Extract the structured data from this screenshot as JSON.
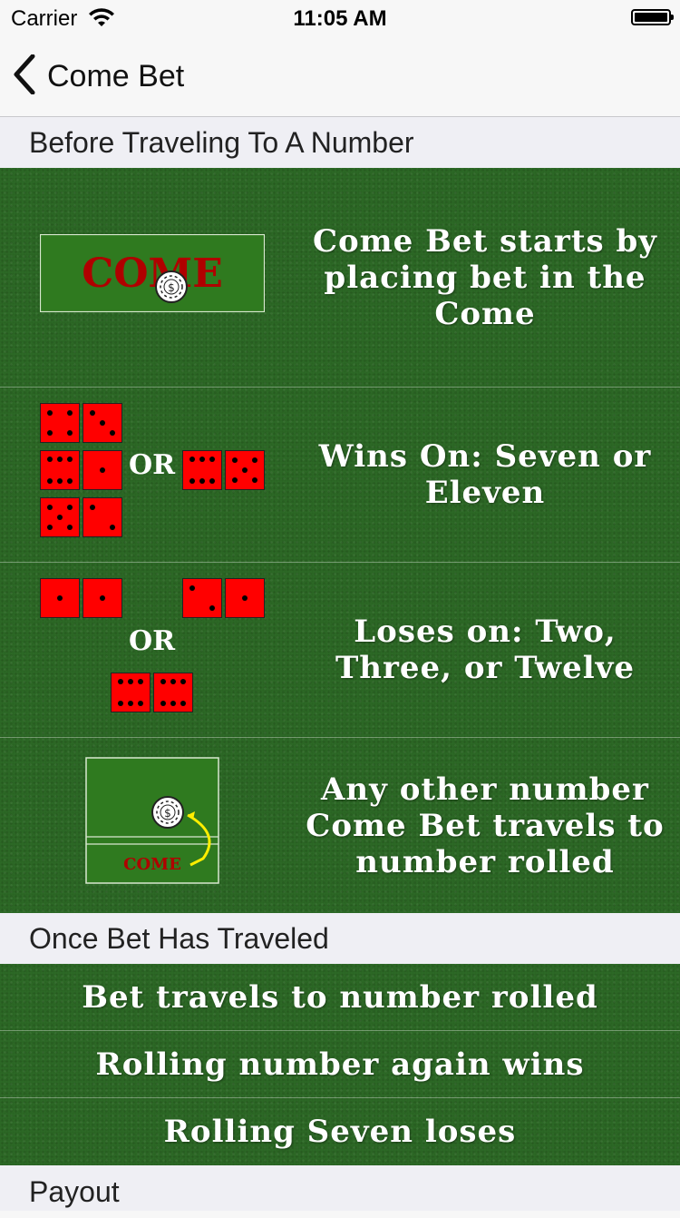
{
  "status_bar": {
    "carrier": "Carrier",
    "time": "11:05 AM"
  },
  "nav": {
    "title": "Come Bet"
  },
  "sections": {
    "before": {
      "title": "Before Traveling To A Number"
    },
    "traveled": {
      "title": "Once Bet Has Traveled"
    },
    "payout": {
      "title": "Payout"
    }
  },
  "before_rows": [
    {
      "text": "Come Bet starts by placing bet in the Come",
      "illustration": "come-box-chip"
    },
    {
      "text": "Wins On: Seven or Eleven",
      "illustration": "dice-seven-eleven",
      "or_label": "OR"
    },
    {
      "text": "Loses on: Two, Three, or Twelve",
      "illustration": "dice-craps",
      "or_label": "OR"
    },
    {
      "text": "Any other number Come Bet travels to number rolled",
      "illustration": "come-travel"
    }
  ],
  "traveled_rows": [
    {
      "text": "Bet travels to number rolled"
    },
    {
      "text": "Rolling number again wins"
    },
    {
      "text": "Rolling Seven loses"
    }
  ],
  "illustration_text": {
    "come": "COME",
    "chip_symbol": "$"
  },
  "colors": {
    "felt": "#2d6a26",
    "die": "#ff0000",
    "pip": "#000000",
    "come_text": "#b00000",
    "arrow": "#ffee00"
  }
}
